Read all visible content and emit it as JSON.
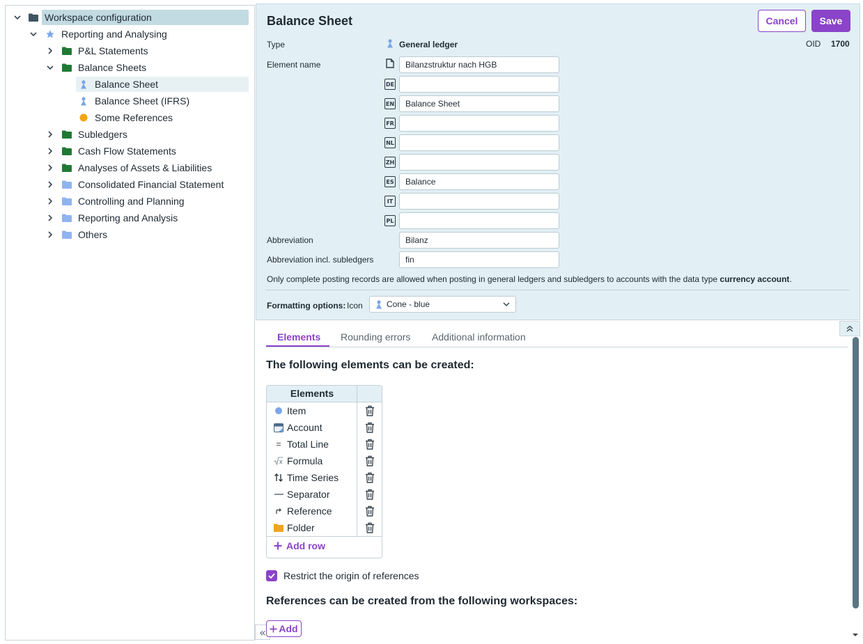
{
  "tree": {
    "root": "Workspace configuration",
    "reporting": "Reporting and Analysing",
    "pl": "P&L Statements",
    "balance_sheets": "Balance Sheets",
    "balance_sheet": "Balance Sheet",
    "balance_sheet_ifrs": "Balance Sheet (IFRS)",
    "some_references": "Some References",
    "subledgers": "Subledgers",
    "cash_flow": "Cash Flow Statements",
    "analyses": "Analyses of Assets & Liabilities",
    "consolidated": "Consolidated Financial Statement",
    "controlling": "Controlling and Planning",
    "reporting_analysis": "Reporting and Analysis",
    "others": "Others"
  },
  "detail": {
    "title": "Balance Sheet",
    "cancel": "Cancel",
    "save": "Save",
    "type_label": "Type",
    "type_value": "General ledger",
    "oid_label": "OID",
    "oid_value": "1700",
    "element_name_label": "Element name",
    "name_default": "Bilanzstruktur nach HGB",
    "langs": {
      "de": {
        "code": "DE",
        "value": ""
      },
      "en": {
        "code": "EN",
        "value": "Balance Sheet"
      },
      "fr": {
        "code": "FR",
        "value": ""
      },
      "nl": {
        "code": "NL",
        "value": ""
      },
      "zh": {
        "code": "ZH",
        "value": ""
      },
      "es": {
        "code": "ES",
        "value": "Balance"
      },
      "it": {
        "code": "IT",
        "value": ""
      },
      "pl": {
        "code": "PL",
        "value": ""
      }
    },
    "abbr_label": "Abbreviation",
    "abbr_value": "Bilanz",
    "abbr_sub_label": "Abbreviation incl. subledgers",
    "abbr_sub_value": "fin",
    "note_pre": "Only complete posting records are allowed when posting in general ledgers and subledgers to accounts with the data type ",
    "note_bold": "currency account",
    "note_post": ".",
    "formatting_label": "Formatting options:",
    "icon_label": "Icon",
    "icon_value": "Cone - blue"
  },
  "tabs": {
    "elements": "Elements",
    "rounding": "Rounding errors",
    "additional": "Additional information"
  },
  "elements": {
    "heading": "The following elements can be created:",
    "column": "Elements",
    "rows": [
      "Item",
      "Account",
      "Total Line",
      "Formula",
      "Time Series",
      "Separator",
      "Reference",
      "Folder"
    ],
    "add_row": "Add row"
  },
  "restrict": {
    "label": "Restrict the origin of references",
    "checked": true
  },
  "references": {
    "heading": "References can be created from the following workspaces:",
    "add": "Add"
  },
  "colors": {
    "accent": "#8b43c9",
    "panel_bg": "#e2eff4",
    "folder_green": "#1f7a33",
    "folder_blue": "#8fb4f0",
    "star": "#7aa6ea",
    "dot_orange": "#f2a516"
  }
}
